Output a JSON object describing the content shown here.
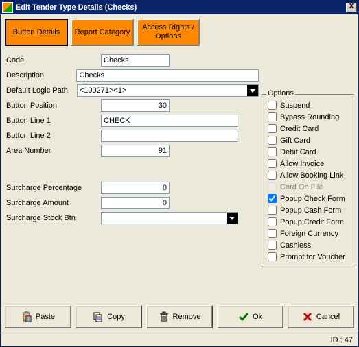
{
  "window": {
    "title": "Edit Tender Type Details (Checks)"
  },
  "tabs": {
    "button_details": "Button Details",
    "report_category": "Report Category",
    "access_rights": "Access Rights / Options"
  },
  "labels": {
    "code": "Code",
    "description": "Description",
    "default_logic_path": "Default Logic Path",
    "button_position": "Button Position",
    "button_line1": "Button Line 1",
    "button_line2": "Button Line 2",
    "area_number": "Area Number",
    "surcharge_percentage": "Surcharge Percentage",
    "surcharge_amount": "Surcharge Amount",
    "surcharge_stock_btn": "Surcharge Stock Btn",
    "options_legend": "Options"
  },
  "fields": {
    "code": "Checks",
    "description": "Checks",
    "default_logic_path": "<100271><1>",
    "button_position": "30",
    "button_line1": "CHECK",
    "button_line2": "",
    "area_number": "91",
    "surcharge_percentage": "0",
    "surcharge_amount": "0",
    "surcharge_stock_btn": ""
  },
  "options": [
    {
      "label": "Suspend",
      "checked": false,
      "disabled": false
    },
    {
      "label": "Bypass Rounding",
      "checked": false,
      "disabled": false
    },
    {
      "label": "Credit Card",
      "checked": false,
      "disabled": false
    },
    {
      "label": "Gift Card",
      "checked": false,
      "disabled": false
    },
    {
      "label": "Debit Card",
      "checked": false,
      "disabled": false
    },
    {
      "label": "Allow Invoice",
      "checked": false,
      "disabled": false
    },
    {
      "label": "Allow Booking Link",
      "checked": false,
      "disabled": false
    },
    {
      "label": "Card On File",
      "checked": false,
      "disabled": true
    },
    {
      "label": "Popup Check Form",
      "checked": true,
      "disabled": false
    },
    {
      "label": "Popup Cash Form",
      "checked": false,
      "disabled": false
    },
    {
      "label": "Popup Credit Form",
      "checked": false,
      "disabled": false
    },
    {
      "label": "Foreign Currency",
      "checked": false,
      "disabled": false
    },
    {
      "label": "Cashless",
      "checked": false,
      "disabled": false
    },
    {
      "label": "Prompt for Voucher",
      "checked": false,
      "disabled": false
    }
  ],
  "buttons": {
    "paste": "Paste",
    "copy": "Copy",
    "remove": "Remove",
    "ok": "Ok",
    "cancel": "Cancel"
  },
  "status": {
    "id_label": "ID : 47"
  }
}
